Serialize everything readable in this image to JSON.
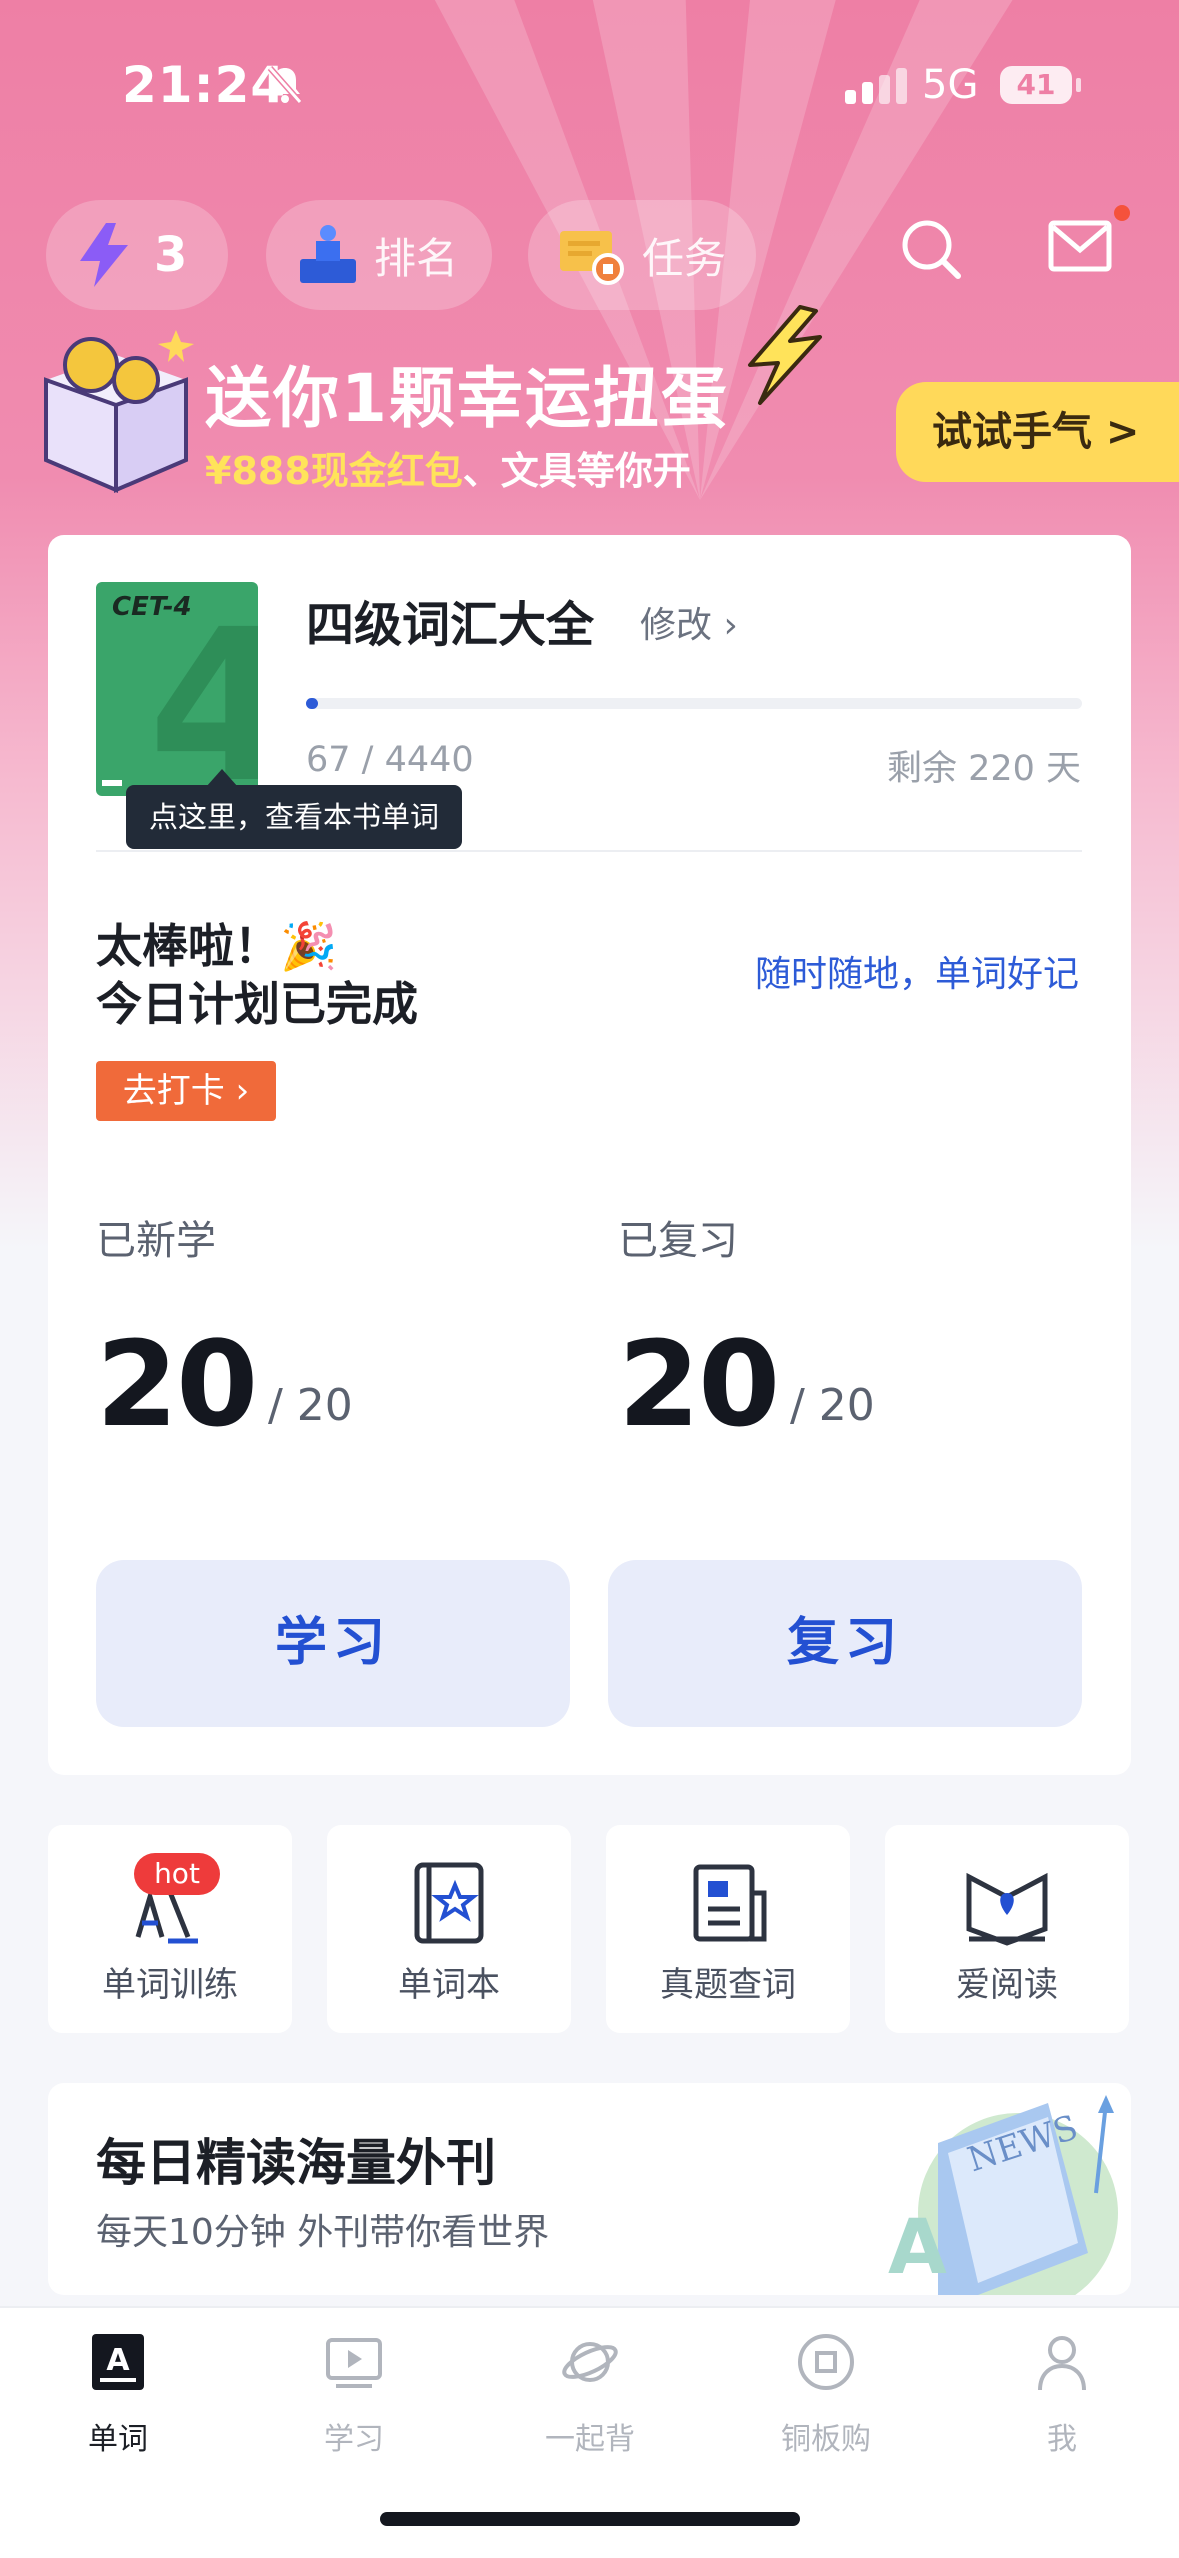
{
  "status": {
    "time": "21:24",
    "network": "5G",
    "battery": "41"
  },
  "topbar": {
    "energy_count": "3",
    "rank_label": "排名",
    "task_label": "任务",
    "mail_unread": true
  },
  "promo": {
    "title": "送你1颗幸运扭蛋",
    "sub_highlight": "¥888现金红包",
    "sub_rest": "、文具等你开",
    "button": "试试手气 >"
  },
  "book": {
    "cover_label": "CET-4",
    "cover_digit": "4",
    "title": "四级词汇大全",
    "edit_label": "修改 ›",
    "tooltip": "点这里，查看本书单词",
    "progress_text": "67 / 4440",
    "progress_fraction": 0.015,
    "remaining": "剩余 220 天"
  },
  "today": {
    "line1": "太棒啦！🎉",
    "line2": "今日计划已完成",
    "slogan": "随时随地，单词好记",
    "checkin": "去打卡 ›"
  },
  "stats": {
    "new": {
      "label": "已新学",
      "value": "20",
      "total": "/  20"
    },
    "review": {
      "label": "已复习",
      "value": "20",
      "total": "/  20"
    }
  },
  "actions": {
    "study": "学习",
    "review": "复习"
  },
  "tools": [
    {
      "label": "单词训练",
      "badge": "hot",
      "icon": "word-training-icon"
    },
    {
      "label": "单词本",
      "icon": "wordbook-icon"
    },
    {
      "label": "真题查词",
      "icon": "exam-lookup-icon"
    },
    {
      "label": "爱阅读",
      "icon": "reading-icon"
    }
  ],
  "news": {
    "title": "每日精读海量外刊",
    "subtitle": "每天10分钟 外刊带你看世界",
    "art_text": "NEWS",
    "art_letter": "A"
  },
  "tabs": [
    {
      "label": "单词",
      "active": true
    },
    {
      "label": "学习"
    },
    {
      "label": "一起背"
    },
    {
      "label": "铜板购"
    },
    {
      "label": "我"
    }
  ],
  "colors": {
    "accent": "#2d5bd7",
    "brand_pink": "#ee7fa5",
    "checkin": "#f06a3a",
    "book_green": "#3aa56a"
  }
}
